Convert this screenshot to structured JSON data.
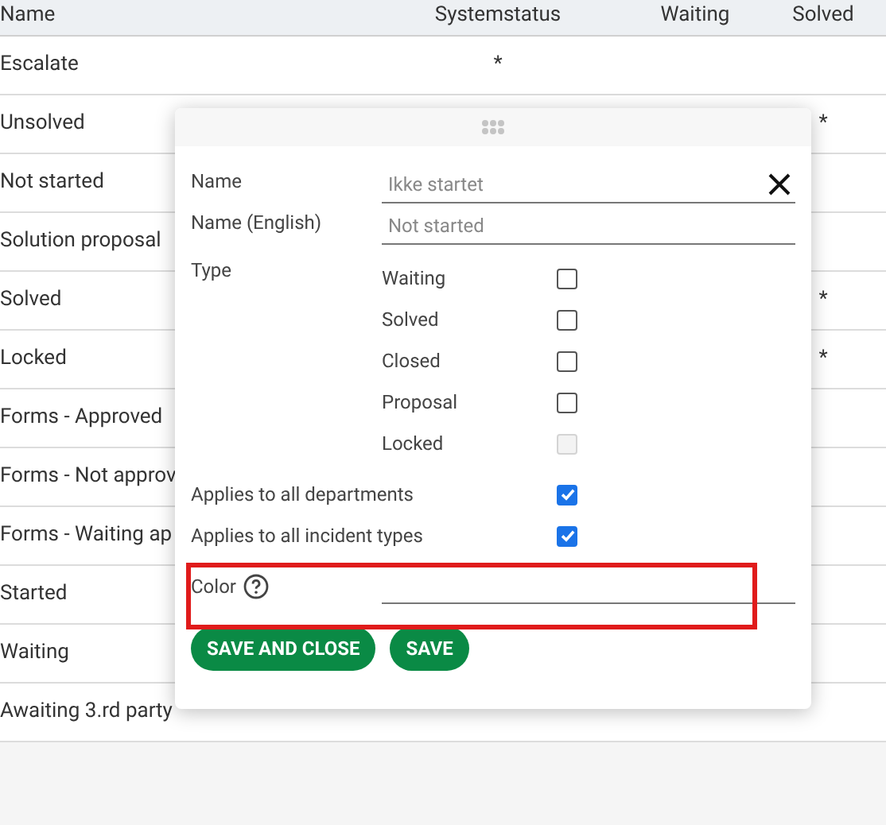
{
  "table": {
    "columns": [
      {
        "label": "Name"
      },
      {
        "label": "Systemstatus"
      },
      {
        "label": "Waiting"
      },
      {
        "label": "Solved"
      }
    ],
    "rows": [
      {
        "name": "Escalate",
        "systemstatus": "*"
      },
      {
        "name": "Unsolved",
        "solved": "*"
      },
      {
        "name": "Not started"
      },
      {
        "name": "Solution proposal"
      },
      {
        "name": "Solved",
        "solved": "*"
      },
      {
        "name": "Locked",
        "solved": "*"
      },
      {
        "name": "Forms - Approved"
      },
      {
        "name": "Forms - Not approv"
      },
      {
        "name": "Forms - Waiting ap"
      },
      {
        "name": "Started"
      },
      {
        "name": "Waiting"
      },
      {
        "name": "Awaiting 3.rd party"
      }
    ]
  },
  "dialog": {
    "fields": [
      {
        "label": "Name",
        "value": "Ikke startet",
        "closable": true
      },
      {
        "label": "Name (English)",
        "value": "Not started",
        "closable": false
      }
    ],
    "type_label": "Type",
    "types": [
      {
        "label": "Waiting",
        "checked": false,
        "disabled": false
      },
      {
        "label": "Solved",
        "checked": false,
        "disabled": false
      },
      {
        "label": "Closed",
        "checked": false,
        "disabled": false
      },
      {
        "label": "Proposal",
        "checked": false,
        "disabled": false
      },
      {
        "label": "Locked",
        "checked": false,
        "disabled": true
      }
    ],
    "applies": [
      {
        "label": "Applies to all departments",
        "checked": true
      },
      {
        "label": "Applies to all incident types",
        "checked": true
      }
    ],
    "color_field": {
      "label": "Color"
    },
    "buttons": [
      "SAVE AND CLOSE",
      "SAVE"
    ]
  }
}
